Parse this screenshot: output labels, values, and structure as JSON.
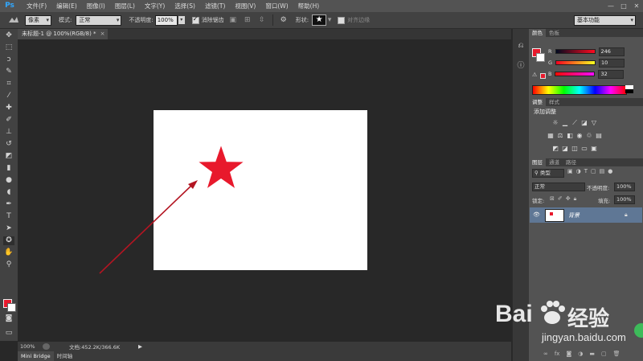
{
  "app": {
    "logo": "Ps"
  },
  "menu": [
    "文件(F)",
    "编辑(E)",
    "图像(I)",
    "图层(L)",
    "文字(Y)",
    "选择(S)",
    "滤镜(T)",
    "视图(V)",
    "窗口(W)",
    "帮助(H)"
  ],
  "window_controls": [
    "—",
    "□",
    "✕"
  ],
  "options": {
    "unit_select": "像素",
    "mode_label": "模式:",
    "mode_value": "正常",
    "opacity_label": "不透明度:",
    "opacity_value": "100%",
    "antialias_label": "消除锯齿",
    "antialias_checked": true,
    "shape_label": "形状:",
    "shape_glyph": "★",
    "align_edges_label": "对齐边缘",
    "align_edges_checked": false,
    "workspace": "基本功能"
  },
  "document": {
    "tab_title": "未标题-1 @ 100%(RGB/8) *",
    "close": "×",
    "star_color": "#e8192c",
    "arrow_color": "#b31522"
  },
  "status": {
    "zoom": "100%",
    "doc_info": "文档:452.2K/366.6K"
  },
  "bottom_tabs": [
    "Mini Bridge",
    "时间轴"
  ],
  "color_panel": {
    "tabs": [
      "颜色",
      "色板"
    ],
    "fg": "#e8192c",
    "r_label": "R",
    "r_value": "246",
    "g_label": "G",
    "g_value": "10",
    "b_label": "B",
    "b_value": "32"
  },
  "adjust_panel": {
    "tabs": [
      "调整",
      "样式"
    ],
    "add_label": "添加调整"
  },
  "layers_panel": {
    "tabs": [
      "图层",
      "通道",
      "路径"
    ],
    "filter_kind": "类型",
    "blend_mode": "正常",
    "opacity_label": "不透明度:",
    "opacity_value": "100%",
    "lock_label": "锁定:",
    "fill_label": "填充:",
    "fill_value": "100%",
    "layer_name": "背景"
  },
  "watermark": {
    "brand": "Bai",
    "brand2": "经验",
    "url": "jingyan.baidu.com"
  }
}
